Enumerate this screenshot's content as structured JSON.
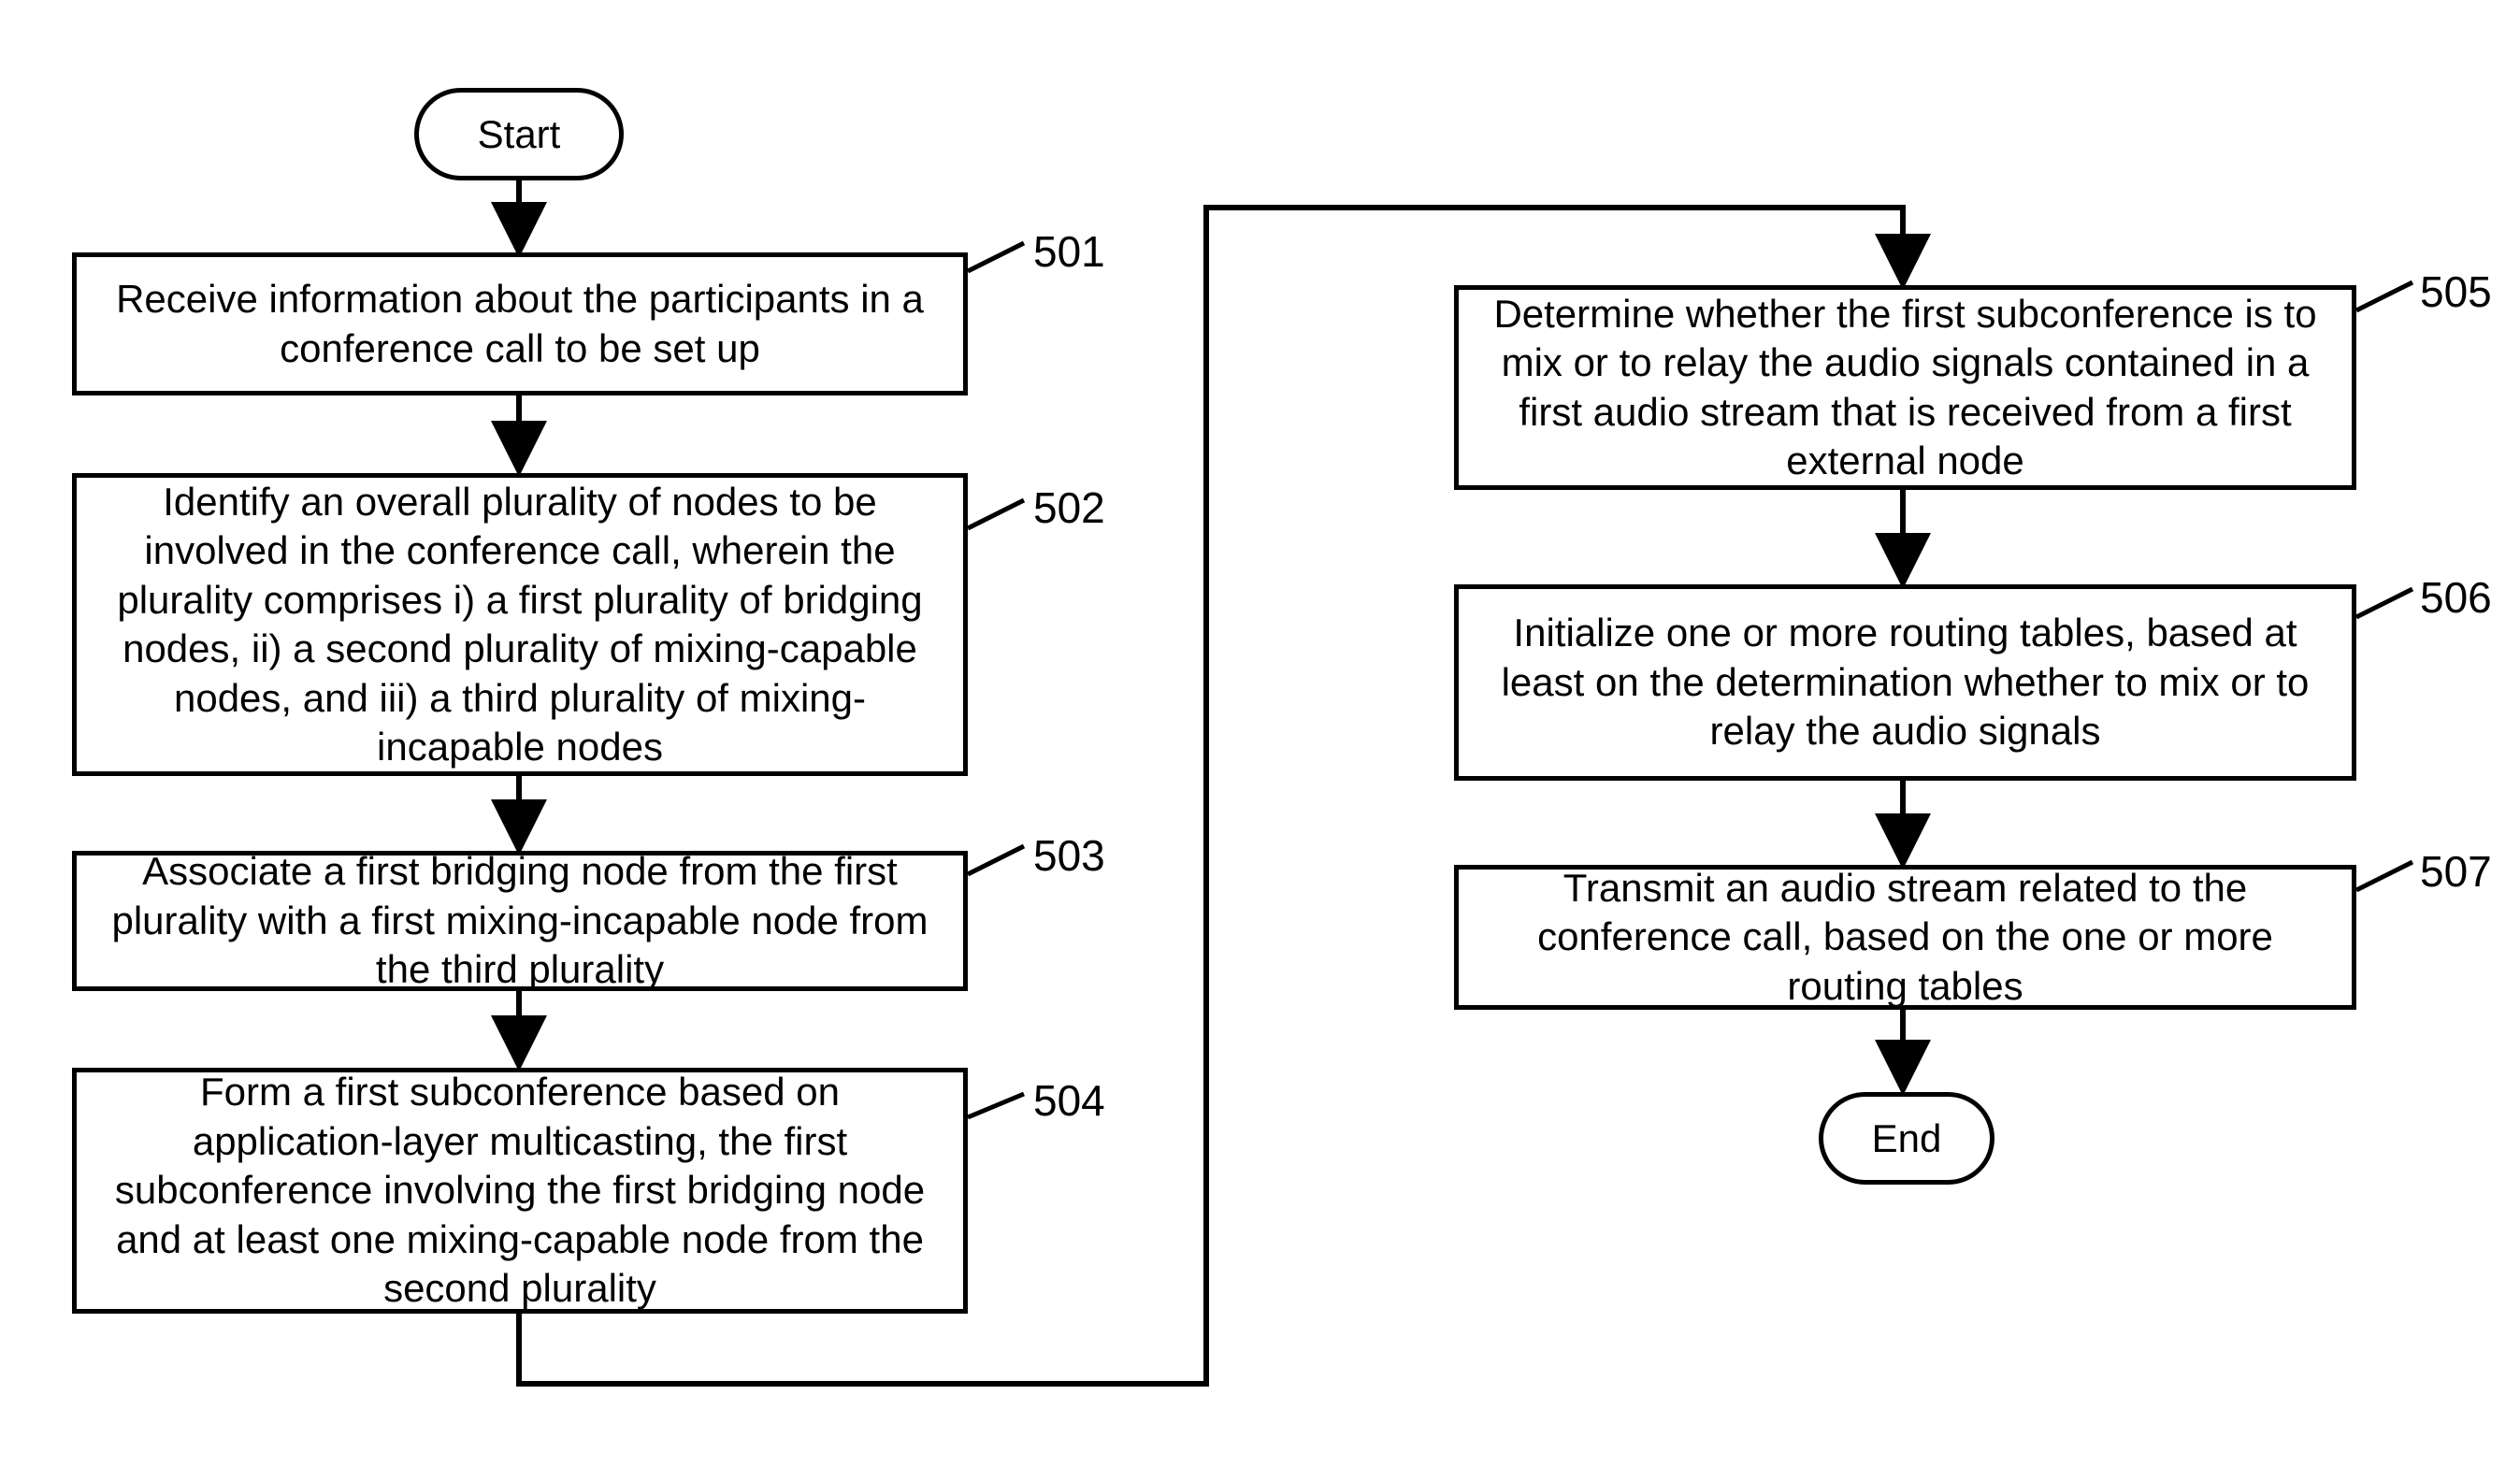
{
  "terminals": {
    "start": "Start",
    "end": "End"
  },
  "steps": {
    "s501": {
      "text": "Receive information about the participants in a conference call to be set up",
      "ref": "501"
    },
    "s502": {
      "text": "Identify an overall plurality of nodes to be involved in the conference call, wherein the plurality comprises i) a first plurality of bridging nodes, ii) a second plurality of mixing-capable nodes, and iii) a third plurality of mixing-incapable nodes",
      "ref": "502"
    },
    "s503": {
      "text": "Associate a first bridging node from the first plurality with a first mixing-incapable node from the third plurality",
      "ref": "503"
    },
    "s504": {
      "text": "Form a first subconference based on application-layer multicasting, the first subconference involving the first bridging node and at least one mixing-capable node from the second plurality",
      "ref": "504"
    },
    "s505": {
      "text": "Determine whether the first subconference is to mix or to relay the audio signals contained in a first audio stream that is received from a first external node",
      "ref": "505"
    },
    "s506": {
      "text": "Initialize one or more routing tables, based at least on the determination whether to mix or to relay the audio signals",
      "ref": "506"
    },
    "s507": {
      "text": "Transmit an audio stream related to the conference call, based on the one or more routing tables",
      "ref": "507"
    }
  }
}
